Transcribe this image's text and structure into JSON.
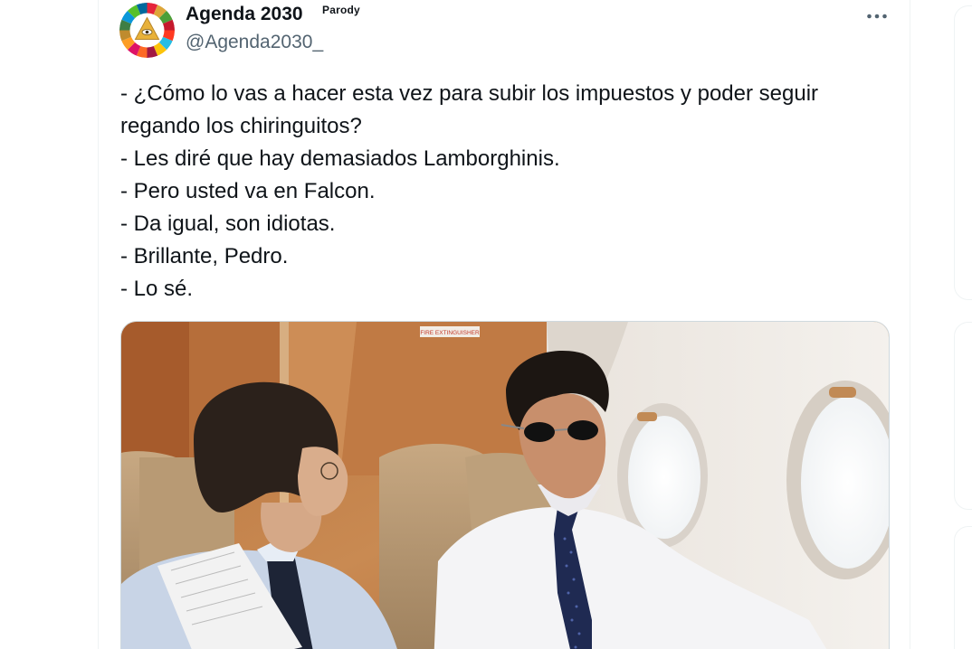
{
  "tweet": {
    "author": {
      "display_name": "Agenda 2030",
      "badge": "Parody",
      "handle": "@Agenda2030_"
    },
    "more_icon": "more-horizontal-icon",
    "text_lines": [
      "- ¿Cómo lo vas a hacer esta vez para subir los impuestos y poder seguir",
      "regando los chiringuitos?",
      "- Les diré que hay demasiados Lamborghinis.",
      "- Pero usted va en Falcon.",
      "- Da igual, son idiotas.",
      "- Brillante, Pedro.",
      "- Lo sé."
    ],
    "photo": {
      "sign_text": "FIRE EXTINGUISHER"
    }
  },
  "colors": {
    "text_primary": "#0f1419",
    "text_secondary": "#536471",
    "border": "#eff3f4",
    "media_border": "#cfd9de"
  }
}
